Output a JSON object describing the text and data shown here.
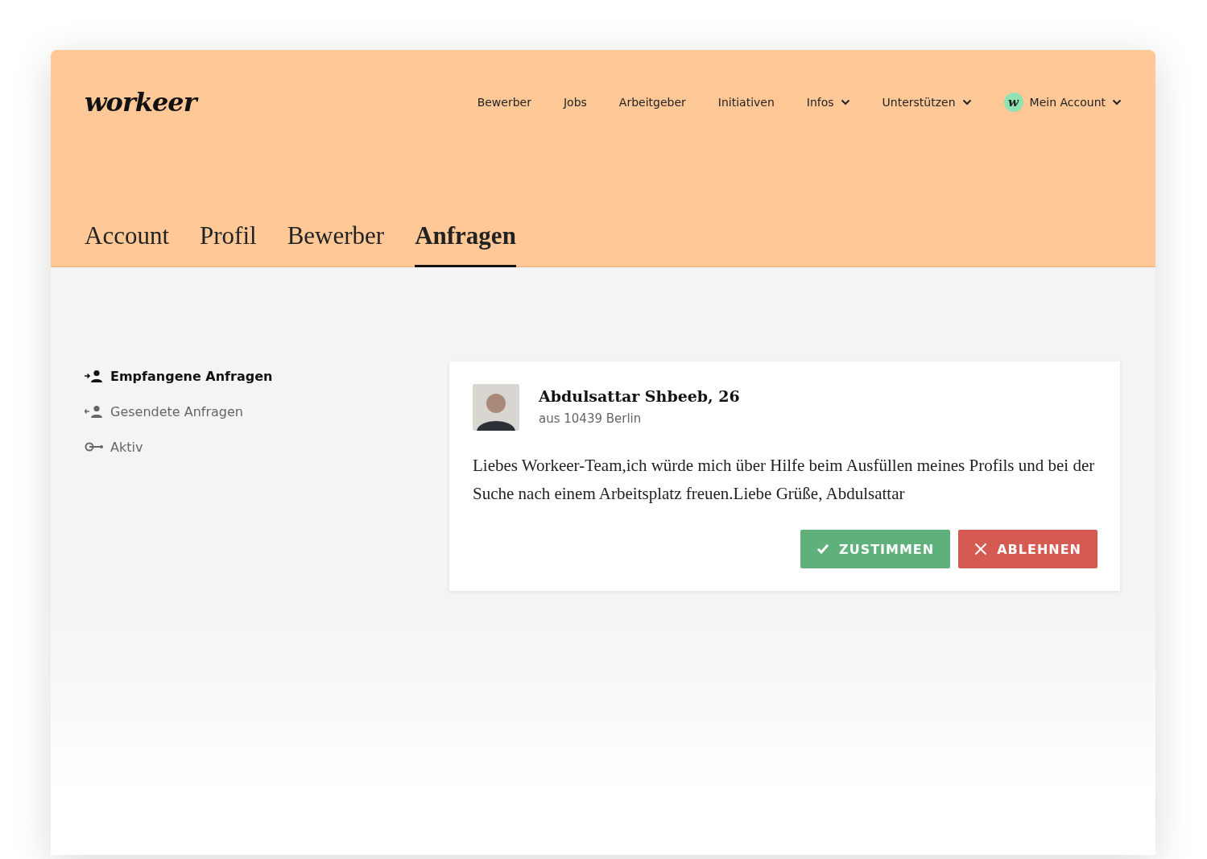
{
  "header": {
    "logo": "workeer",
    "nav": [
      {
        "label": "Bewerber",
        "dropdown": false
      },
      {
        "label": "Jobs",
        "dropdown": false
      },
      {
        "label": "Arbeitgeber",
        "dropdown": false
      },
      {
        "label": "Initiativen",
        "dropdown": false
      },
      {
        "label": "Infos",
        "dropdown": true
      },
      {
        "label": "Unterstützen",
        "dropdown": true
      }
    ],
    "account": {
      "avatar_letter": "w",
      "label": "Mein Account",
      "dropdown": true
    }
  },
  "tabs": [
    {
      "label": "Account",
      "selected": false
    },
    {
      "label": "Profil",
      "selected": false
    },
    {
      "label": "Bewerber",
      "selected": false
    },
    {
      "label": "Anfragen",
      "selected": true
    }
  ],
  "sidebar": {
    "items": [
      {
        "label": "Empfangene Anfragen",
        "kind": "received",
        "selected": true
      },
      {
        "label": "Gesendete Anfragen",
        "kind": "sent",
        "selected": false
      },
      {
        "label": "Aktiv",
        "kind": "active",
        "selected": false
      }
    ]
  },
  "requests": [
    {
      "name": "Abdulsattar Shbeeb, 26",
      "location": "aus 10439 Berlin",
      "message": "Liebes Workeer-Team,ich würde mich über Hilfe beim Ausfüllen meines Profils und bei der Suche nach einem Arbeitsplatz freuen.Liebe Grüße, Abdulsattar",
      "buttons": [
        {
          "label": "ZUSTIMMEN",
          "kind": "accept"
        },
        {
          "label": "ABLEHNEN",
          "kind": "decline"
        }
      ]
    }
  ]
}
